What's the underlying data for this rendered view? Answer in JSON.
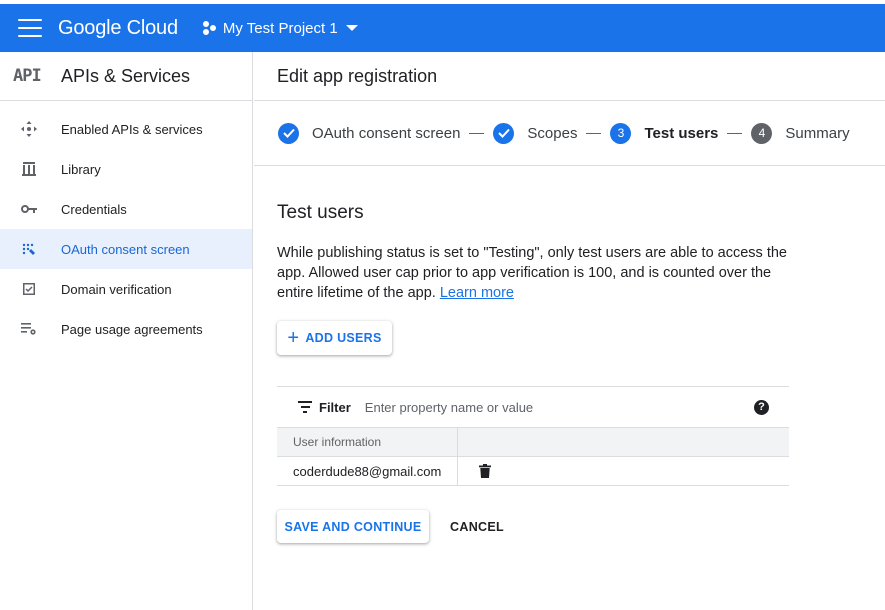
{
  "topbar": {
    "brand": "Google Cloud",
    "project_name": "My Test Project 1",
    "color": "#1a73e8"
  },
  "sidebar": {
    "logo": "API",
    "title": "APIs & Services",
    "items": [
      {
        "label": "Enabled APIs & services",
        "icon": "enabled-apis-icon",
        "active": false
      },
      {
        "label": "Library",
        "icon": "library-icon",
        "active": false
      },
      {
        "label": "Credentials",
        "icon": "key-icon",
        "active": false
      },
      {
        "label": "OAuth consent screen",
        "icon": "oauth-consent-icon",
        "active": true
      },
      {
        "label": "Domain verification",
        "icon": "checkbox-icon",
        "active": false
      },
      {
        "label": "Page usage agreements",
        "icon": "settings-list-icon",
        "active": false
      }
    ]
  },
  "main": {
    "header_title": "Edit app registration",
    "stepper": [
      {
        "number": "1",
        "label": "OAuth consent screen",
        "state": "done"
      },
      {
        "number": "2",
        "label": "Scopes",
        "state": "done"
      },
      {
        "number": "3",
        "label": "Test users",
        "state": "current"
      },
      {
        "number": "4",
        "label": "Summary",
        "state": "pending"
      }
    ],
    "section_title": "Test users",
    "description": "While publishing status is set to \"Testing\", only test users are able to access the app. Allowed user cap prior to app verification is 100, and is counted over the entire lifetime of the app.",
    "learn_more": "Learn more",
    "add_users_label": "ADD USERS",
    "filter": {
      "label": "Filter",
      "placeholder": "Enter property name or value",
      "help": "?"
    },
    "table": {
      "columns": [
        "User information",
        ""
      ],
      "rows": [
        {
          "user": "coderdude88@gmail.com"
        }
      ]
    },
    "save_label": "SAVE AND CONTINUE",
    "cancel_label": "CANCEL"
  }
}
